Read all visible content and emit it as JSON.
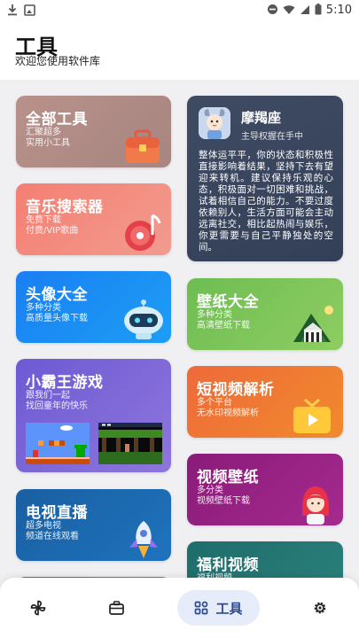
{
  "status_bar": {
    "time": "5:10",
    "icons": [
      "download-icon",
      "image-icon",
      "dnd-icon",
      "wifi-icon",
      "signal-icon",
      "battery-icon"
    ]
  },
  "header": {
    "title": "工具",
    "subtitle": "欢迎您使用软件库"
  },
  "left_cards": [
    {
      "title": "全部工具",
      "desc": [
        "汇聚超多",
        "实用小工具"
      ],
      "icon": "toolbox-icon",
      "color": "#b48f88"
    },
    {
      "title": "音乐搜索器",
      "desc": [
        "免费下载",
        "付费/VIP歌曲"
      ],
      "icon": "music-disc-icon",
      "color": "#f4867a"
    },
    {
      "title": "头像大全",
      "desc": [
        "多种分类",
        "高质量头像下载"
      ],
      "icon": "robot-icon",
      "color": "#1a8bf4"
    },
    {
      "title": "小霸王游戏",
      "desc": [
        "跟我们一起",
        "找回童年的快乐"
      ],
      "icon": "game-screenshots",
      "color": "#7a64d8"
    },
    {
      "title": "电视直播",
      "desc": [
        "超多电视",
        "频道在线观看"
      ],
      "icon": "rocket-icon",
      "color": "#1b66ac"
    }
  ],
  "horoscope_card": {
    "name": "摩羯座",
    "sub": "主导权握在手中",
    "text": "整体运平平，你的状态和积极性直接影响着结果，坚持下去有望迎来转机。建议保持乐观的心态，积极面对一切困难和挑战，试着相信自己的能力。不要过度依赖别人，生活方面可能会主动远离社交，相比起热闹与娱乐，你更需要与自己平静独处的空间。",
    "icon": "capricorn-avatar"
  },
  "right_cards": [
    {
      "title": "壁纸大全",
      "desc": [
        "多种分类",
        "高清壁纸下载"
      ],
      "icon": "landscape-icon",
      "color": "#7cc55a"
    },
    {
      "title": "短视频解析",
      "desc": [
        "多个平台",
        "无水印视频解析"
      ],
      "icon": "tv-play-icon",
      "color": "#ef7a33"
    },
    {
      "title": "视频壁纸",
      "desc": [
        "多分类",
        "视频壁纸下载"
      ],
      "icon": "girl-icon",
      "color": "#962284"
    },
    {
      "title": "福利视频",
      "desc": [
        "福利视频"
      ],
      "icon": "",
      "color": "#247674"
    }
  ],
  "bottom_nav": [
    {
      "name": "pinwheel-icon",
      "label": ""
    },
    {
      "name": "toolbox-nav-icon",
      "label": ""
    },
    {
      "name": "tools-tab",
      "label": "工具"
    },
    {
      "name": "settings-icon",
      "label": ""
    }
  ]
}
